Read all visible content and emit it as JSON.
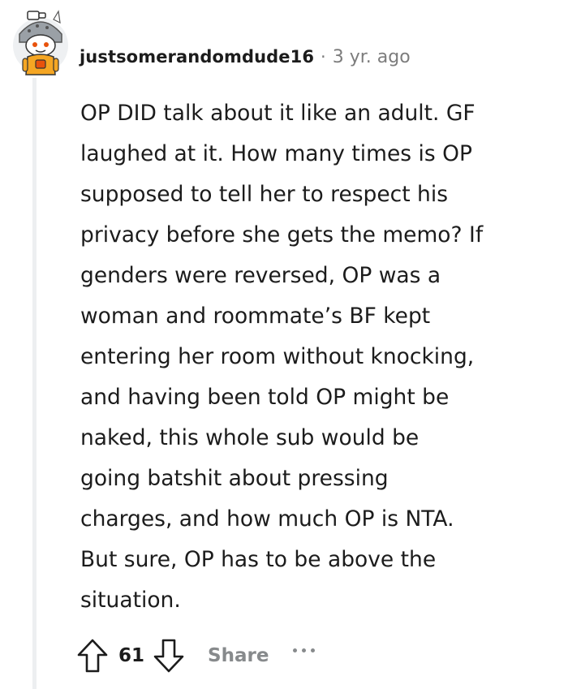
{
  "comment": {
    "username": "justsomerandomdude16",
    "separator": "·",
    "timestamp": "3 yr. ago",
    "body_lines": [
      "OP DID talk about it like an adult. GF",
      "laughed at it. How many times is OP",
      "supposed to tell her to respect his",
      "privacy before she gets the memo? If",
      "genders were reversed, OP was a",
      "woman and roommate’s BF kept",
      "entering her room without knocking,",
      "and having been told OP might be",
      "naked, this whole sub would be",
      "going batshit about pressing",
      "charges, and how much OP is NTA.",
      "But sure, OP has to be above the",
      "situation."
    ]
  },
  "actions": {
    "upvote_icon": "arrow-up-outline-icon",
    "score": "61",
    "downvote_icon": "arrow-down-outline-icon",
    "share_label": "Share",
    "more_icon": "ellipsis-icon"
  },
  "avatar": {
    "icon": "snoo-avatar-icon",
    "colors": {
      "helmet": "#9aa0a6",
      "face": "#ffffff",
      "body": "#f5a623",
      "accent": "#e8520c"
    }
  },
  "colors": {
    "text": "#1c1c1c",
    "meta": "#7c7c7c",
    "muted_action": "#878a8c",
    "thread_line": "#edeff1"
  }
}
